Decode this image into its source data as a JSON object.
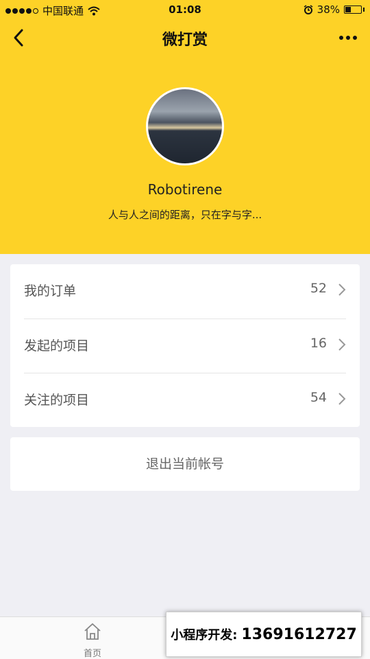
{
  "status_bar": {
    "carrier": "中国联通",
    "time": "01:08",
    "battery_percent_text": "38%",
    "battery_level": 0.38
  },
  "nav": {
    "title": "微打赏"
  },
  "profile": {
    "username": "Robotirene",
    "bio": "人与人之间的距离，只在字与字..."
  },
  "menu": [
    {
      "label": "我的订单",
      "count": "52"
    },
    {
      "label": "发起的项目",
      "count": "16"
    },
    {
      "label": "关注的项目",
      "count": "54"
    }
  ],
  "logout_label": "退出当前帐号",
  "tabbar": {
    "home_label": "首页"
  },
  "promo": {
    "label": "小程序开发:",
    "phone": "13691612727"
  },
  "colors": {
    "header_bg": "#fdd227",
    "page_bg": "#efeff4"
  },
  "icons": [
    "back-icon",
    "more-icon",
    "wifi-icon",
    "alarm-icon",
    "battery-icon",
    "chevron-right-icon",
    "home-icon"
  ]
}
